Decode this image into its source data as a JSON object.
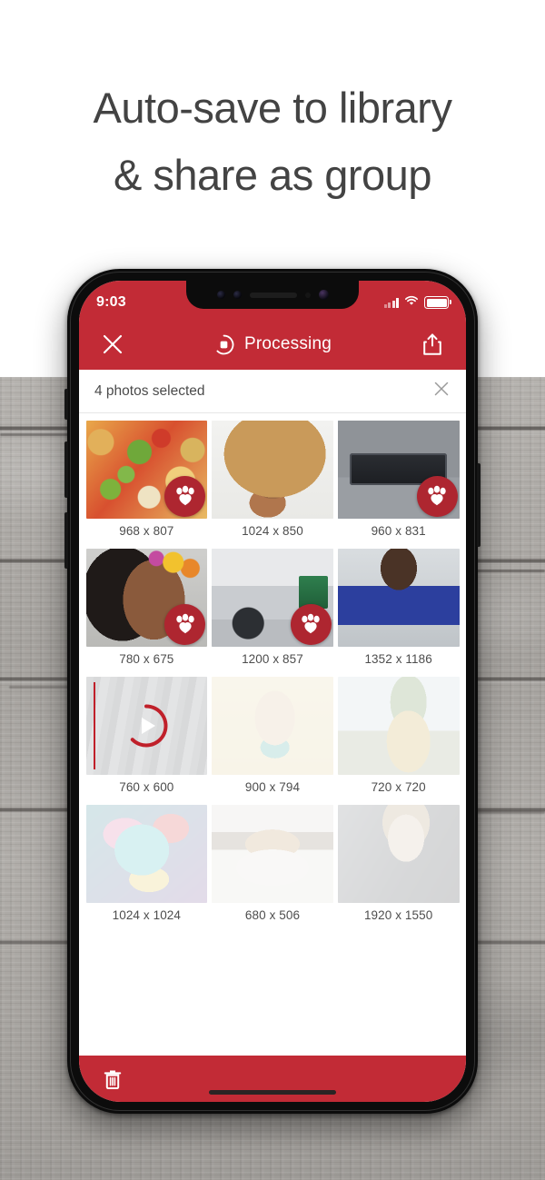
{
  "headline": "Auto-save to library\n& share as group",
  "colors": {
    "brand_red": "#c22b36",
    "badge_red": "#ae2630",
    "headline": "#434343"
  },
  "phone": {
    "status_bar": {
      "time": "9:03",
      "signal_icon": "signal-bars-icon",
      "wifi_icon": "wifi-icon",
      "battery_icon": "battery-icon"
    },
    "app_bar": {
      "close_icon": "close-icon",
      "status_icon": "stop-processing-icon",
      "title": "Processing",
      "share_icon": "share-icon"
    },
    "selection_bar": {
      "text": "4 photos selected",
      "clear_icon": "close-icon"
    },
    "bottom_bar": {
      "delete_icon": "trash-icon",
      "home_indicator": "home-indicator"
    }
  },
  "grid": {
    "items": [
      {
        "caption": "968 x 807",
        "art": "art-pizza",
        "badge": "paw-badge",
        "faded": false,
        "video": false
      },
      {
        "caption": "1024 x 850",
        "art": "art-curly",
        "badge": null,
        "faded": false,
        "video": false
      },
      {
        "caption": "960 x 831",
        "art": "art-boombox",
        "badge": "paw-badge",
        "faded": false,
        "video": false
      },
      {
        "caption": "780 x 675",
        "art": "art-flowers",
        "badge": "paw-badge",
        "faded": false,
        "video": false
      },
      {
        "caption": "1200 x 857",
        "art": "art-car",
        "badge": "paw-badge",
        "faded": false,
        "video": false
      },
      {
        "caption": "1352 x 1186",
        "art": "art-gym",
        "badge": null,
        "faded": false,
        "video": false
      },
      {
        "caption": "760 x 600",
        "art": "art-football",
        "badge": null,
        "faded": true,
        "video": true
      },
      {
        "caption": "900 x 794",
        "art": "art-yellow",
        "badge": null,
        "faded": true,
        "video": false
      },
      {
        "caption": "720 x 720",
        "art": "art-pineapple",
        "badge": null,
        "faded": true,
        "video": false
      },
      {
        "caption": "1024 x 1024",
        "art": "art-einstein",
        "badge": null,
        "faded": true,
        "video": false
      },
      {
        "caption": "680 x 506",
        "art": "art-coffee",
        "badge": null,
        "faded": true,
        "video": false
      },
      {
        "caption": "1920 x 1550",
        "art": "art-portrait",
        "badge": null,
        "faded": true,
        "video": false
      }
    ]
  }
}
